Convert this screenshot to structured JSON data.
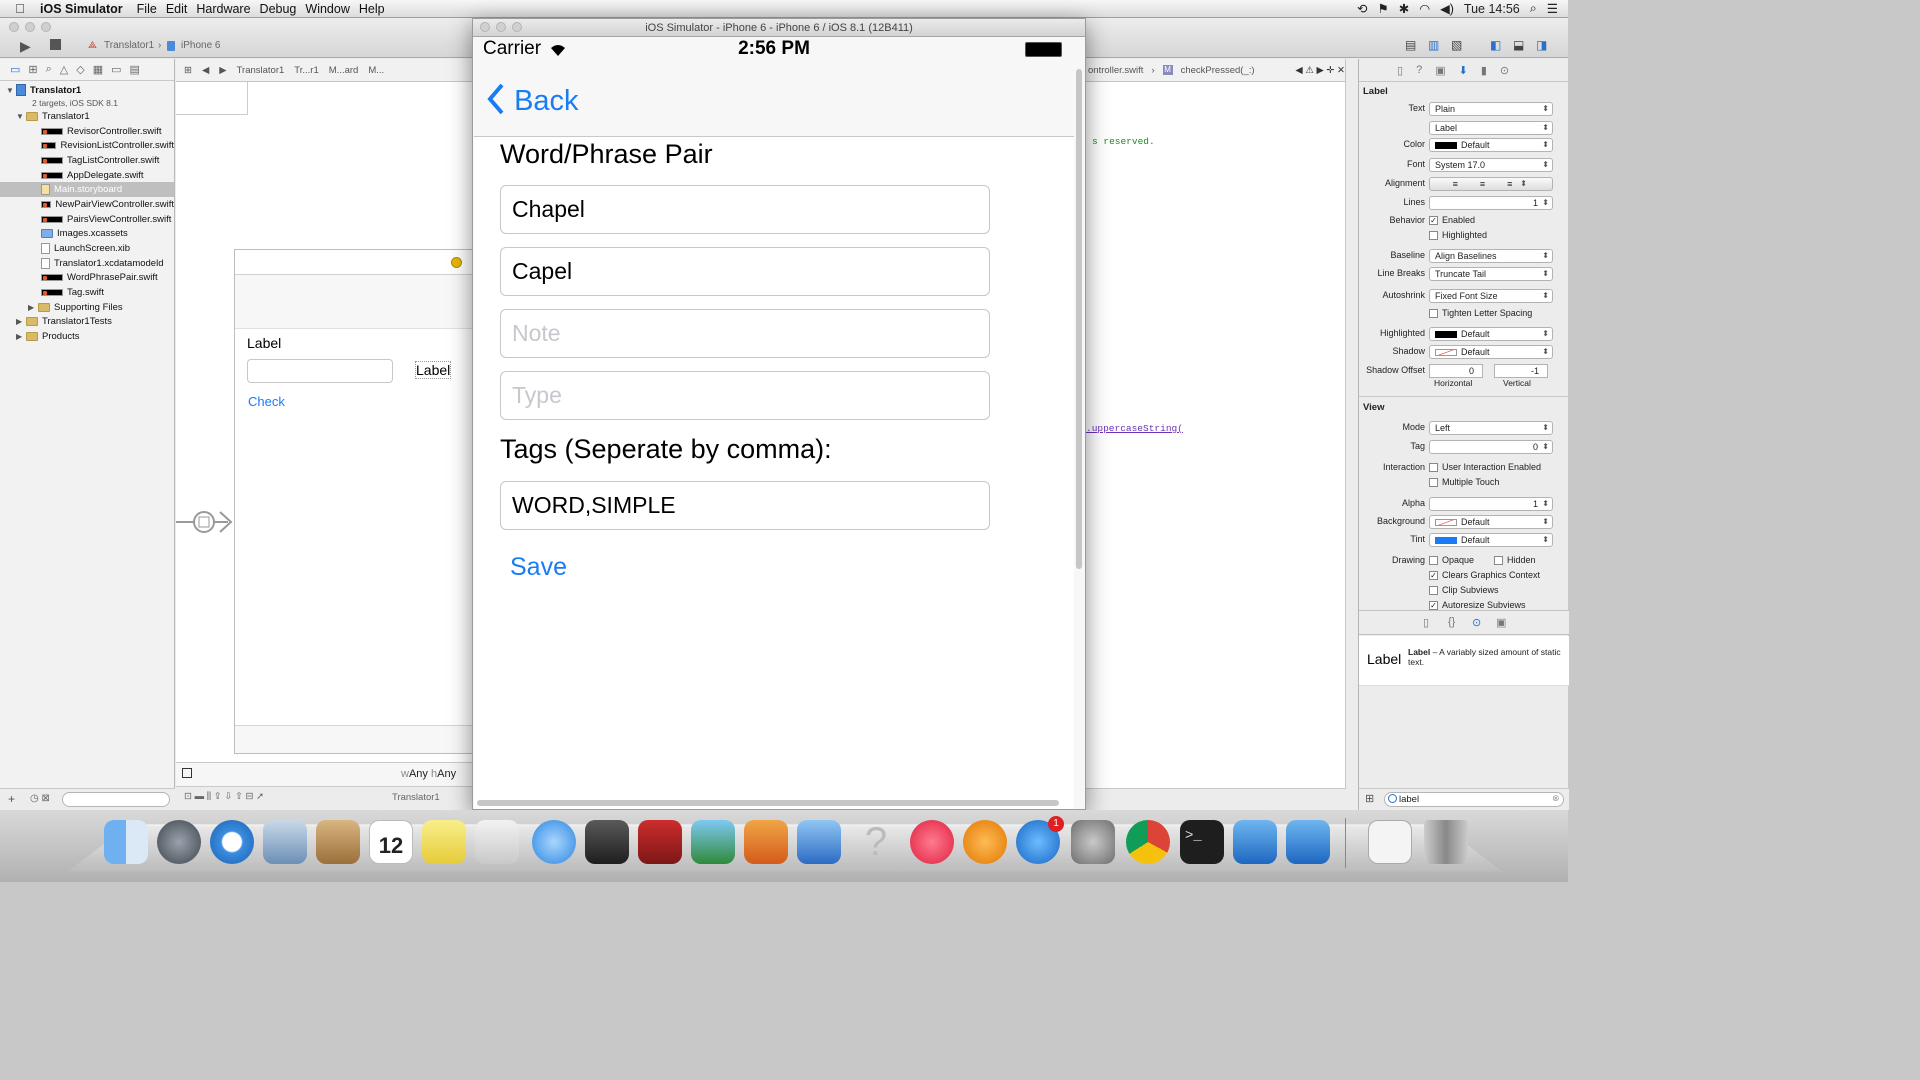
{
  "menubar": {
    "app": "iOS Simulator",
    "items": [
      "File",
      "Edit",
      "Hardware",
      "Debug",
      "Window",
      "Help"
    ],
    "clock": "Tue 14:56"
  },
  "xcode": {
    "scheme": {
      "target": "Translator1",
      "device": "iPhone 6"
    },
    "navigator": {
      "project": "Translator1",
      "project_sub": "2 targets, iOS SDK 8.1",
      "group": "Translator1",
      "files": [
        "RevisorController.swift",
        "RevisionListController.swift",
        "TagListController.swift",
        "AppDelegate.swift",
        "Main.storyboard",
        "NewPairViewController.swift",
        "PairsViewController.swift",
        "Images.xcassets",
        "LaunchScreen.xib",
        "Translator1.xcdatamodeld",
        "WordPhrasePair.swift",
        "Tag.swift"
      ],
      "folders": [
        "Supporting Files",
        "Translator1Tests",
        "Products"
      ]
    },
    "jumpbar": [
      "Translator1",
      "Tr...r1",
      "M...ard",
      "M..."
    ],
    "canvas": {
      "label1": "Label",
      "label2": "Label",
      "check": "Check",
      "size_w": "w",
      "size_w_val": "Any",
      "size_h": "h",
      "size_h_val": "Any",
      "footer_item": "Translator1"
    },
    "editor": {
      "jump_file": "ontroller.swift",
      "jump_method": "checkPressed(_:)",
      "line1": "s reserved.",
      "line2": ".uppercaseString("
    },
    "inspector": {
      "section_label": "Label",
      "text_label": "Text",
      "text_value": "Plain",
      "text_content": "Label",
      "color_label": "Color",
      "color_value": "Default",
      "font_label": "Font",
      "font_value": "System 17.0",
      "alignment_label": "Alignment",
      "lines_label": "Lines",
      "lines_value": "1",
      "behavior_label": "Behavior",
      "enabled": "Enabled",
      "highlighted": "Highlighted",
      "baseline_label": "Baseline",
      "baseline_value": "Align Baselines",
      "linebreaks_label": "Line Breaks",
      "linebreaks_value": "Truncate Tail",
      "autoshrink_label": "Autoshrink",
      "autoshrink_value": "Fixed Font Size",
      "tighten": "Tighten Letter Spacing",
      "highlighted_label": "Highlighted",
      "highlighted_value": "Default",
      "shadow_label": "Shadow",
      "shadow_value": "Default",
      "shadow_offset_label": "Shadow Offset",
      "shadow_h": "0",
      "shadow_v": "-1",
      "horizontal": "Horizontal",
      "vertical": "Vertical",
      "section_view": "View",
      "mode_label": "Mode",
      "mode_value": "Left",
      "tag_label": "Tag",
      "tag_value": "0",
      "interaction_label": "Interaction",
      "user_interaction": "User Interaction Enabled",
      "multiple_touch": "Multiple Touch",
      "alpha_label": "Alpha",
      "alpha_value": "1",
      "background_label": "Background",
      "background_value": "Default",
      "tint_label": "Tint",
      "tint_value": "Default",
      "drawing_label": "Drawing",
      "opaque": "Opaque",
      "hidden": "Hidden",
      "clears": "Clears Graphics Context",
      "clip": "Clip Subviews",
      "autoresize": "Autoresize Subviews",
      "lib_title": "Label",
      "lib_name": "Label",
      "lib_desc": " – A variably sized amount of static text.",
      "filter_value": "label"
    }
  },
  "simulator": {
    "title": "iOS Simulator - iPhone 6 - iPhone 6 / iOS 8.1 (12B411)",
    "carrier": "Carrier",
    "time": "2:56 PM",
    "back": "Back",
    "heading": "Word/Phrase Pair",
    "word": "Chapel",
    "phrase": "Capel",
    "note_placeholder": "Note",
    "type_placeholder": "Type",
    "tags_label": "Tags (Seperate by comma):",
    "tags_value": "WORD,SIMPLE",
    "save": "Save"
  },
  "colors": {
    "ios_blue": "#1a7cf5",
    "xcode_selection": "#bfbfbf",
    "code_green": "#1e8b1e",
    "code_purple": "#6a32b8"
  }
}
